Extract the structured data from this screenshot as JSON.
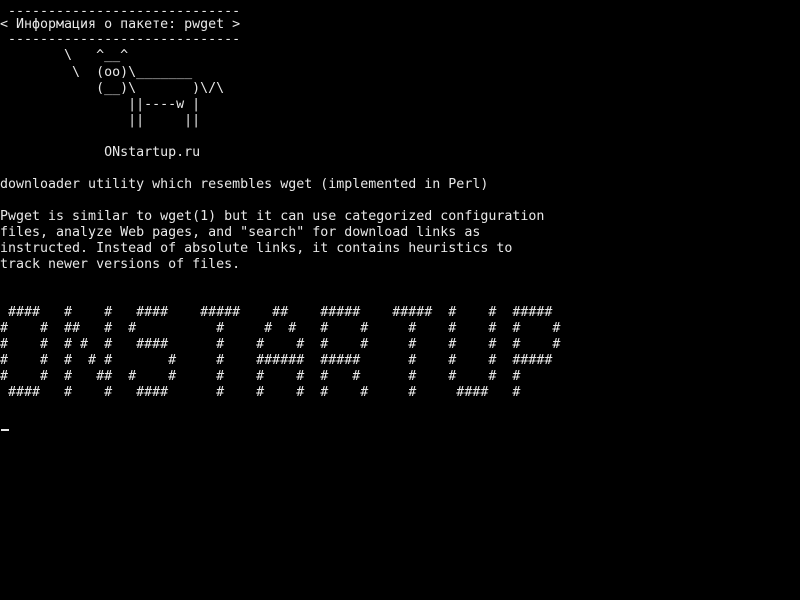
{
  "colors": {
    "background": "#000000",
    "foreground": "#e8e8e8"
  },
  "bubble": {
    "border_top": " -----------------------------",
    "title": "< Информация о пакете: pwget >",
    "border_bottom": " -----------------------------"
  },
  "cow": [
    "        \\   ^__^",
    "         \\  (oo)\\_______",
    "            (__)\\       )\\/\\",
    "                ||----w |",
    "                ||     ||"
  ],
  "site": "             ONstartup.ru",
  "summary": "downloader utility which resembles wget (implemented in Perl)",
  "description": [
    "Pwget is similar to wget(1) but it can use categorized configuration",
    "files, analyze Web pages, and \"search\" for download links as",
    "instructed. Instead of absolute links, it contains heuristics to",
    "track newer versions of files."
  ],
  "banner": [
    " ####   #    #   ####    #####    ##    #####    #####  #    #  #####",
    "#    #  ##   #  #          #     #  #   #    #     #    #    #  #    #",
    "#    #  # #  #   ####      #    #    #  #    #     #    #    #  #    #",
    "#    #  #  # #       #     #    ######  #####      #    #    #  #####",
    "#    #  #   ##  #    #     #    #    #  #   #      #    #    #  #",
    " ####   #    #   ####      #    #    #  #    #     #     ####   #"
  ]
}
